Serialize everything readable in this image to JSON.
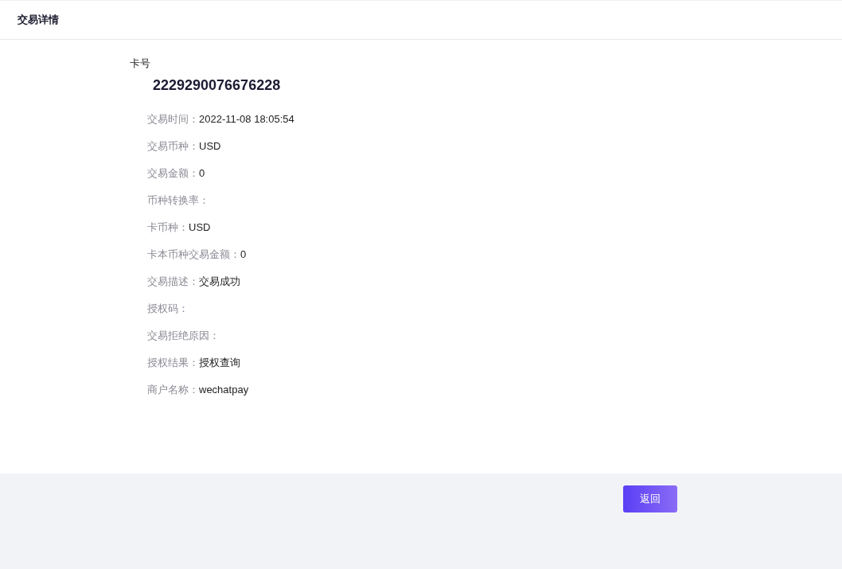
{
  "header": {
    "title": "交易详情"
  },
  "card": {
    "label": "卡号",
    "number": "2229290076676228"
  },
  "fields": [
    {
      "label": "交易时间：",
      "value": "2022-11-08 18:05:54"
    },
    {
      "label": "交易币种：",
      "value": "USD"
    },
    {
      "label": "交易金额：",
      "value": "0"
    },
    {
      "label": "币种转换率："
    },
    {
      "label": "卡币种：",
      "value": "USD"
    },
    {
      "label": "卡本币种交易金额：",
      "value": "0"
    },
    {
      "label": "交易描述：",
      "value": "交易成功"
    },
    {
      "label": "授权码："
    },
    {
      "label": "交易拒绝原因："
    },
    {
      "label": "授权结果：",
      "value": "授权查询"
    },
    {
      "label": "商户名称：",
      "value": "wechatpay"
    }
  ],
  "footer": {
    "button": "返回"
  }
}
